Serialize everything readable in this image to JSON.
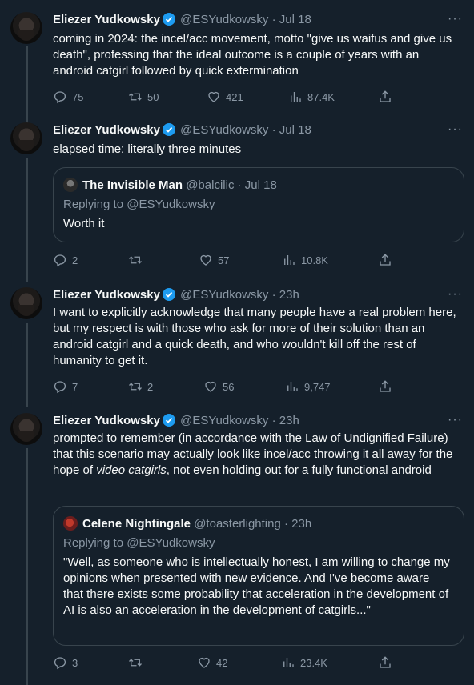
{
  "tweets": [
    {
      "author": "Eliezer Yudkowsky",
      "handle": "@ESYudkowsky",
      "time": "Jul 18",
      "text": "coming in 2024:  the incel/acc movement, motto \"give us waifus and give us death\", professing that the ideal outcome is a couple of years with an android catgirl followed by quick extermination",
      "replies": "75",
      "retweets": "50",
      "likes": "421",
      "views": "87.4K"
    },
    {
      "author": "Eliezer Yudkowsky",
      "handle": "@ESYudkowsky",
      "time": "Jul 18",
      "text": "elapsed time: literally three minutes",
      "quote": {
        "author": "The Invisible Man",
        "handle": "@balcilic",
        "time": "Jul 18",
        "replying": "Replying to @ESYudkowsky",
        "text": "Worth it"
      },
      "replies": "2",
      "retweets": "",
      "likes": "57",
      "views": "10.8K"
    },
    {
      "author": "Eliezer Yudkowsky",
      "handle": "@ESYudkowsky",
      "time": "23h",
      "text": "I want to explicitly acknowledge that many people have a real problem here, but my respect is with those who ask for more of their solution than an android catgirl and a quick death, and who wouldn't kill off the rest of humanity to get it.",
      "replies": "7",
      "retweets": "2",
      "likes": "56",
      "views": "9,747"
    },
    {
      "author": "Eliezer Yudkowsky",
      "handle": "@ESYudkowsky",
      "time": "23h",
      "text_before": "prompted to remember (in accordance with the Law of Undignified Failure) that this scenario may actually look like incel/acc throwing it all away for the hope of ",
      "text_italic": "video catgirls",
      "text_after": ", not even holding out for a fully functional android",
      "quote": {
        "author": "Celene Nightingale",
        "handle": "@toasterlighting",
        "time": "23h",
        "replying": "Replying to @ESYudkowsky",
        "text": "\"Well, as someone who is intellectually honest, I am willing to change my opinions when presented with new evidence. And I've become aware that there exists some probability that acceleration in the development of AI is also an acceleration in the development of catgirls...\""
      },
      "replies": "3",
      "retweets": "",
      "likes": "42",
      "views": "23.4K"
    }
  ],
  "separator": "·",
  "more_glyph": "···"
}
